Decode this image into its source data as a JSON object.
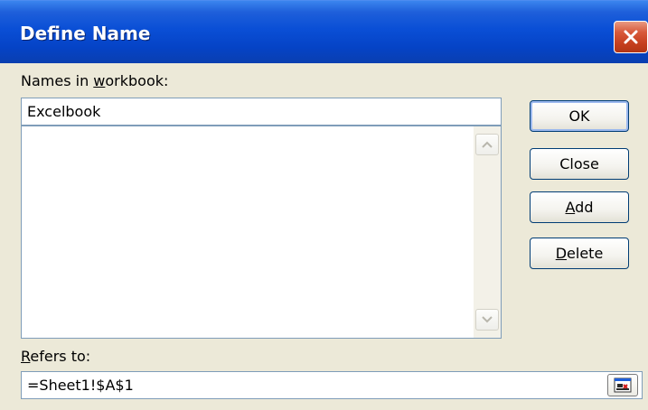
{
  "window": {
    "title": "Define Name"
  },
  "names_section": {
    "label_pre": "Names in ",
    "label_accel": "w",
    "label_post": "orkbook:",
    "input_value": "Excelbook",
    "list_items": []
  },
  "refers_section": {
    "label_accel": "R",
    "label_post": "efers to:",
    "input_value": "=Sheet1!$A$1"
  },
  "buttons": {
    "ok": "OK",
    "close": "Close",
    "add_accel": "A",
    "add_post": "dd",
    "delete_accel": "D",
    "delete_post": "elete"
  },
  "colors": {
    "titlebar": "#0A4FD6",
    "close_button": "#C6401F",
    "dialog_background": "#ECE9D8",
    "input_border": "#7F9DB9"
  },
  "icons": [
    "close-icon",
    "scroll-up-icon",
    "scroll-down-icon",
    "collapse-dialog-icon"
  ]
}
